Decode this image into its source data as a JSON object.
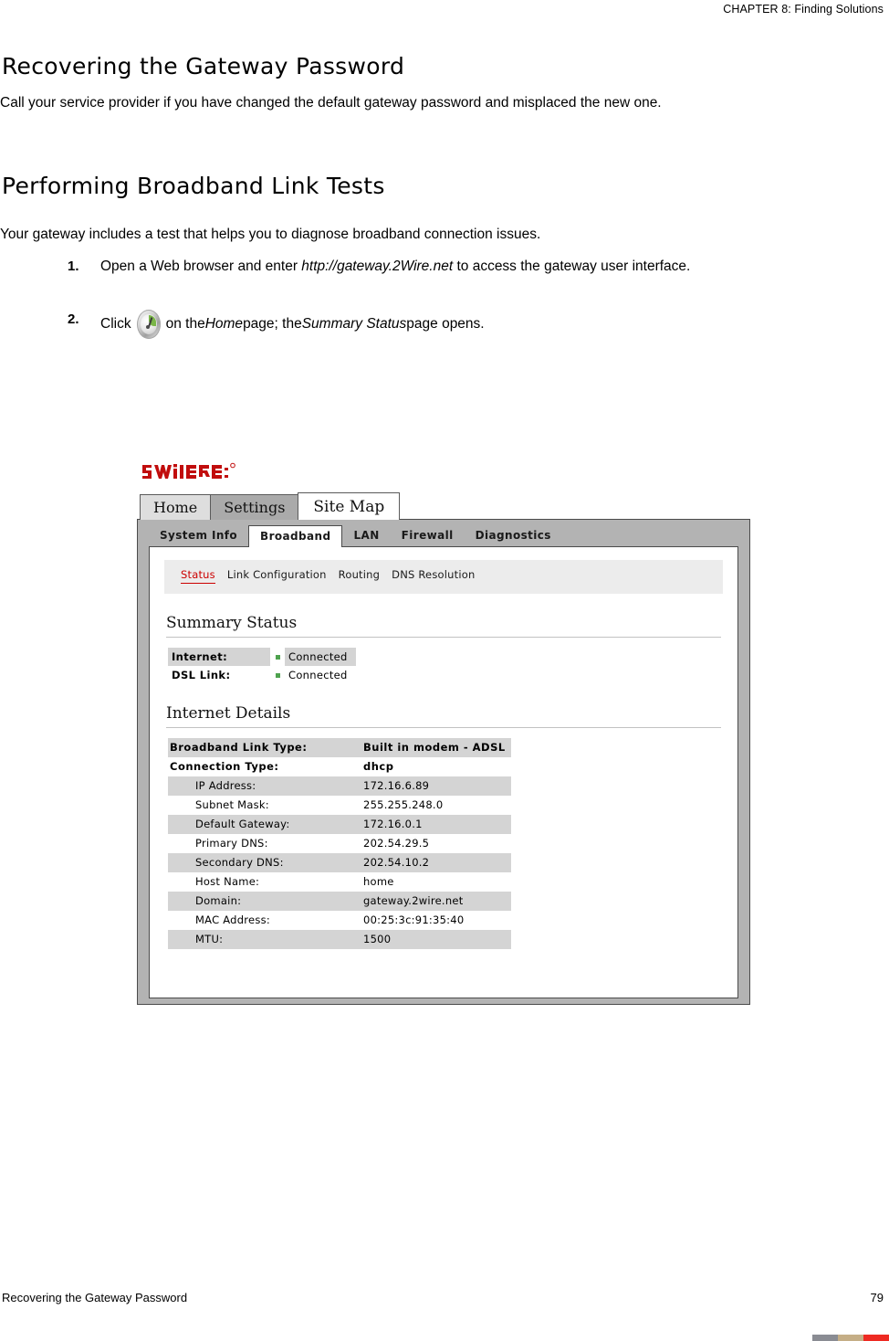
{
  "page_header": "CHAPTER 8: Finding Solutions",
  "sections": [
    {
      "title": "Recovering the Gateway Password",
      "paragraph": "Call your service provider if you have changed the default gateway password and misplaced the new one."
    },
    {
      "title": "Performing Broadband Link Tests",
      "paragraph": "Your gateway includes a test that helps you to diagnose broadband connection issues."
    }
  ],
  "steps": [
    {
      "number": "1.",
      "text_before": "Open a Web browser and enter ",
      "emphasis": "http://gateway.2Wire.net",
      "text_after": " to access the gateway user interface."
    },
    {
      "number": "2.",
      "text_before": "Click",
      "icon": "gauge-icon",
      "mid_1": " on the ",
      "em_1": "Home",
      "mid_2": " page; the ",
      "em_2": "Summary Status",
      "text_after": " page opens."
    }
  ],
  "screenshot": {
    "logo_alt": "2WIRE",
    "brand_color": "#cc0000",
    "primary_tabs": [
      {
        "label": "Home",
        "state": "normal"
      },
      {
        "label": "Settings",
        "state": "hover"
      },
      {
        "label": "Site Map",
        "state": "active"
      }
    ],
    "secondary_tabs": [
      {
        "label": "System Info",
        "active": false
      },
      {
        "label": "Broadband",
        "active": true
      },
      {
        "label": "LAN",
        "active": false
      },
      {
        "label": "Firewall",
        "active": false
      },
      {
        "label": "Diagnostics",
        "active": false
      }
    ],
    "sub_nav": [
      {
        "label": "Status",
        "active": true
      },
      {
        "label": "Link Configuration",
        "active": false
      },
      {
        "label": "Routing",
        "active": false
      },
      {
        "label": "DNS Resolution",
        "active": false
      }
    ],
    "summary_status": {
      "heading": "Summary Status",
      "rows": [
        {
          "label": "Internet:",
          "value": "Connected",
          "shaded": true,
          "dot_color": "#4ea24e"
        },
        {
          "label": "DSL Link:",
          "value": "Connected",
          "shaded": false,
          "dot_color": "#4ea24e"
        }
      ]
    },
    "internet_details": {
      "heading": "Internet Details",
      "rows": [
        {
          "key": "Broadband Link Type:",
          "value": "Built in modem - ADSL",
          "bold": true,
          "indent": false,
          "shaded": true
        },
        {
          "key": "Connection Type:",
          "value": "dhcp",
          "bold": true,
          "indent": false,
          "shaded": false
        },
        {
          "key": "IP Address:",
          "value": "172.16.6.89",
          "bold": false,
          "indent": true,
          "shaded": true
        },
        {
          "key": "Subnet Mask:",
          "value": "255.255.248.0",
          "bold": false,
          "indent": true,
          "shaded": false
        },
        {
          "key": "Default Gateway:",
          "value": "172.16.0.1",
          "bold": false,
          "indent": true,
          "shaded": true
        },
        {
          "key": "Primary DNS:",
          "value": "202.54.29.5",
          "bold": false,
          "indent": true,
          "shaded": false
        },
        {
          "key": "Secondary DNS:",
          "value": "202.54.10.2",
          "bold": false,
          "indent": true,
          "shaded": true
        },
        {
          "key": "Host Name:",
          "value": "home",
          "bold": false,
          "indent": true,
          "shaded": false
        },
        {
          "key": "Domain:",
          "value": "gateway.2wire.net",
          "bold": false,
          "indent": true,
          "shaded": true
        },
        {
          "key": "MAC Address:",
          "value": "00:25:3c:91:35:40",
          "bold": false,
          "indent": true,
          "shaded": false
        },
        {
          "key": "MTU:",
          "value": "1500",
          "bold": false,
          "indent": true,
          "shaded": true
        }
      ]
    }
  },
  "footer": {
    "text": "Recovering the Gateway Password",
    "page_number": "79",
    "bar_colors": [
      "#8a8c93",
      "#c5ae86",
      "#ee2a22"
    ]
  }
}
